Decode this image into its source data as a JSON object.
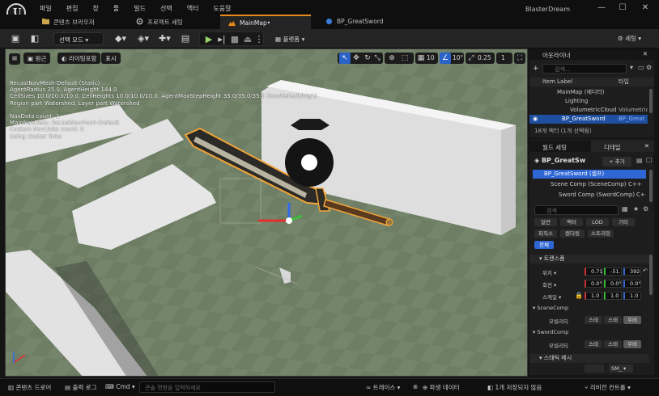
{
  "menu": [
    "파일",
    "편집",
    "창",
    "툴",
    "빌드",
    "선택",
    "액터",
    "도움말"
  ],
  "window_title": "BlasterDream",
  "window_controls": [
    "—",
    "☐",
    "✕"
  ],
  "tabs": [
    {
      "label": "콘텐츠 브라우저"
    },
    {
      "label": "프로젝트 세팅"
    },
    {
      "label": "MainMap•"
    },
    {
      "label": "BP_GreatSword"
    }
  ],
  "toolbar": {
    "mode_label": "선택 모드",
    "platforms_label": "플랫폼",
    "settings_label": "세팅"
  },
  "viewport": {
    "perspective_label": "원근",
    "lit_label": "라이팅포함",
    "show_label": "표시",
    "grid_snap": "10",
    "rot_snap": "10°",
    "scale_snap": "0.25",
    "cam_speed": "1",
    "stats": "RecastNavMesh-Default (Static)\nAgentRadius 35.0, AgentHeight 144.0\nCellSizes 10.0/10.0/10.0, CellHeights 10.0/10.0/10.0, AgentMaxStepHeight 35.0/35.0/35.0 (low/default/high)\nRegion part Watershed, Layer part Watershed\n\nNavData count: 1\nMainNavData: RecastNavMesh-Default\nCustom NavLinks count: 0\nUsing cluster links"
  },
  "outliner": {
    "tab_label": "아웃라이너",
    "search_placeholder": "검색...",
    "col_label": "Item Label",
    "col_type": "타입",
    "rows": [
      {
        "label": "MainMap (에디터)",
        "type": ""
      },
      {
        "label": "Lighting",
        "type": ""
      },
      {
        "label": "VolumetricCloud",
        "type": "Volumetric"
      },
      {
        "label": "BP_GreatSword",
        "type": "BP_Great"
      }
    ],
    "status": "18개 액터 (1개 선택됨)"
  },
  "details": {
    "tab_label": "월드 세팅",
    "tab2_label": "디테일",
    "actor_name": "BP_GreatSw",
    "add_label": "+ 추가",
    "components": [
      {
        "label": "BP_GreatSword (셀프)"
      },
      {
        "label": "Scene Comp (SceneComp)",
        "extra": "C++"
      },
      {
        "label": "Sword Comp (SwordComp)",
        "extra": "C++"
      }
    ],
    "search_placeholder": "검색",
    "filters_row1": [
      "일반",
      "액터",
      "LOD",
      "기타"
    ],
    "filters_row2": [
      "피직스",
      "렌더링",
      "스트리밍"
    ],
    "filter_all": "전체",
    "transform_section": "트랜스폼",
    "location_label": "위치",
    "location": [
      "0.71",
      "-51.",
      "392"
    ],
    "rotation_label": "회전",
    "rotation": [
      "0.0°",
      "0.0°",
      "0.0°"
    ],
    "scale_label": "스케일",
    "scale": [
      "1.0",
      "1.0",
      "1.0"
    ],
    "scene_comp_section": "SceneComp",
    "sword_comp_section": "SwordComp",
    "mobility_label": "모빌리티",
    "mobility_options": [
      "스태",
      "스태",
      "무버"
    ],
    "mobility2_options": [
      "스태",
      "스태",
      "무버"
    ],
    "mesh_section": "스태틱 메시",
    "mesh_sm": "SM_"
  },
  "statusbar": {
    "content_drawer": "콘텐츠 드로어",
    "output_log": "출력 로그",
    "cmd": "Cmd",
    "console_placeholder": "콘솔 명령을 입력하세요",
    "trace": "트레이스",
    "derived": "파생 데이터",
    "unsaved": "1개 저장되지 않음",
    "revision": "리비전 컨트롤"
  },
  "colors": {
    "accent": "#e98a1c",
    "selection": "#1f4fa0",
    "ground": "#6d7d64"
  }
}
